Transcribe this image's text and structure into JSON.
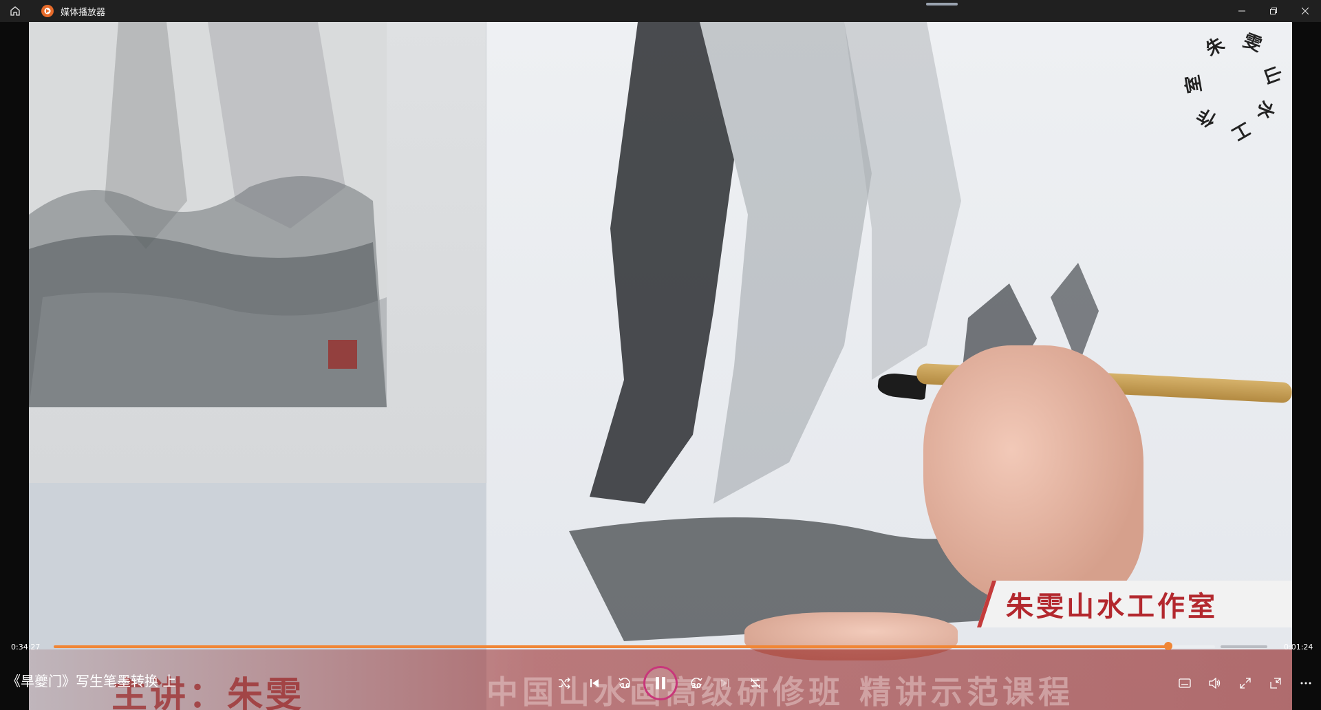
{
  "titlebar": {
    "app_title": "媒体播放器"
  },
  "video": {
    "studio_name": "朱雯山水工作室",
    "seal_chars": [
      "朱",
      "雯",
      "山",
      "水",
      "工",
      "作",
      "室"
    ],
    "lecturer": "主讲：朱雯",
    "course": "中国山水画高级研修班  精讲示范课程"
  },
  "player": {
    "time_elapsed": "0:34:27",
    "time_remaining": "0:01:24",
    "progress_fraction": 0.96,
    "now_playing": "《旱夔门》写生笔墨转换 上",
    "skip_back_label": "10",
    "skip_forward_label": "30",
    "accent_color": "#f08636"
  }
}
